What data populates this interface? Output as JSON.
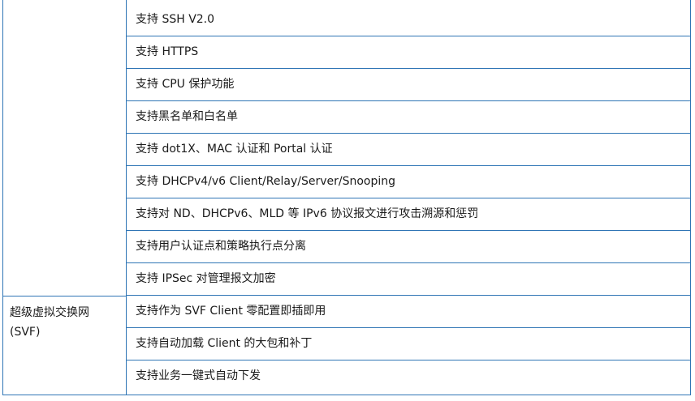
{
  "table": {
    "rows_prev_category": [
      "支持 SSH V2.0",
      "支持 HTTPS",
      "支持 CPU 保护功能",
      "支持黑名单和白名单",
      "支持 dot1X、MAC 认证和 Portal 认证",
      "支持 DHCPv4/v6 Client/Relay/Server/Snooping",
      "支持对 ND、DHCPv6、MLD 等 IPv6 协议报文进行攻击溯源和惩罚",
      "支持用户认证点和策略执行点分离",
      "支持 IPSec 对管理报文加密"
    ],
    "svf_category": {
      "label_line1": "超级虚拟交换网",
      "label_line2": "(SVF)",
      "rows": [
        "支持作为 SVF Client 零配置即插即用",
        "支持自动加载 Client 的大包和补丁",
        "支持业务一键式自动下发"
      ]
    }
  }
}
